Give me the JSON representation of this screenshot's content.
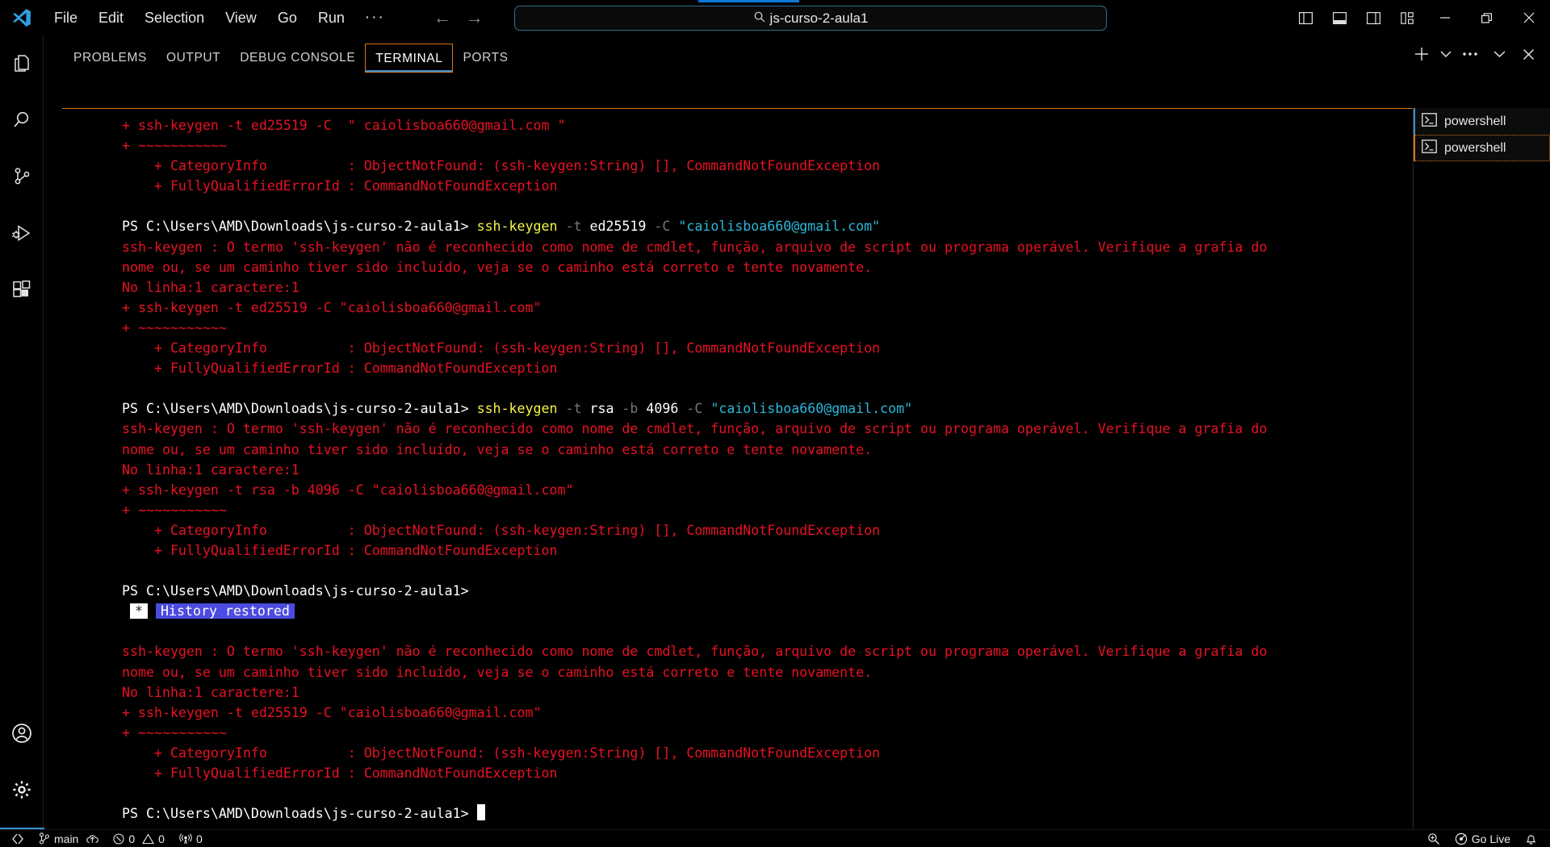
{
  "titlebar": {
    "logo_icon": "vscode-logo-icon",
    "menus": [
      "File",
      "Edit",
      "Selection",
      "View",
      "Go",
      "Run",
      "···"
    ],
    "nav": {
      "back_icon": "arrow-left-icon",
      "forward_icon": "arrow-right-icon"
    },
    "command_center": {
      "search_icon": "search-icon",
      "text": "js-curso-2-aula1",
      "progress_color": "#0a78d4"
    },
    "layout_buttons": [
      "toggle-primary-sidebar-icon",
      "toggle-panel-icon",
      "toggle-secondary-sidebar-icon",
      "customize-layout-icon"
    ],
    "window_buttons": [
      "minimize-icon",
      "restore-icon",
      "close-icon"
    ]
  },
  "activitybar": {
    "items": [
      {
        "name": "explorer",
        "icon": "files-icon"
      },
      {
        "name": "search",
        "icon": "search-icon"
      },
      {
        "name": "source-control",
        "icon": "source-control-icon"
      },
      {
        "name": "run-and-debug",
        "icon": "debug-alt-icon"
      },
      {
        "name": "extensions",
        "icon": "extensions-icon"
      }
    ],
    "bottom_items": [
      {
        "name": "accounts",
        "icon": "account-icon"
      },
      {
        "name": "manage",
        "icon": "gear-icon"
      }
    ]
  },
  "panel": {
    "tabs": [
      {
        "label": "PROBLEMS",
        "active": false
      },
      {
        "label": "OUTPUT",
        "active": false
      },
      {
        "label": "DEBUG CONSOLE",
        "active": false
      },
      {
        "label": "TERMINAL",
        "active": true
      },
      {
        "label": "PORTS",
        "active": false
      }
    ],
    "active_tab": "TERMINAL",
    "actions": [
      {
        "name": "new-terminal",
        "icon": "plus-icon"
      },
      {
        "name": "new-terminal-dropdown",
        "icon": "chevron-down-icon"
      },
      {
        "name": "panel-more-actions",
        "icon": "ellipsis-icon"
      },
      {
        "name": "hide-panel",
        "icon": "chevron-down-icon"
      },
      {
        "name": "close-panel",
        "icon": "close-icon"
      }
    ],
    "accent_border_color": "#d4761a",
    "active_tab_underline_color": "#3794d2"
  },
  "terminal_list": {
    "items": [
      {
        "label": "powershell",
        "icon": "terminal-powershell-icon",
        "selected": true,
        "focused": false
      },
      {
        "label": "powershell",
        "icon": "terminal-powershell-icon",
        "selected": true,
        "focused": true
      }
    ]
  },
  "terminal": {
    "prompt_path": "PS C:\\Users\\AMD\\Downloads\\js-curso-2-aula1>",
    "colors": {
      "error": "#e81123",
      "command": "#f5f543",
      "flag": "#767676",
      "string": "#29b8db",
      "text": "#ffffff",
      "history_highlight_bg": "#4b4bdf"
    },
    "lines": [
      {
        "type": "error",
        "text": "+ ssh-keygen -t ed25519 -C  \" caiolisboa660@gmail.com \""
      },
      {
        "type": "error",
        "text": "+ ~~~~~~~~~~~"
      },
      {
        "type": "error",
        "text": "    + CategoryInfo          : ObjectNotFound: (ssh-keygen:String) [], CommandNotFoundException"
      },
      {
        "type": "error",
        "text": "    + FullyQualifiedErrorId : CommandNotFoundException"
      },
      {
        "type": "blank",
        "text": ""
      },
      {
        "type": "prompt",
        "prompt": "PS C:\\Users\\AMD\\Downloads\\js-curso-2-aula1>",
        "cmd": "ssh-keygen",
        "args": [
          {
            "text": "-t",
            "color": "flag"
          },
          {
            "text": "ed25519",
            "color": "text"
          },
          {
            "text": "-C",
            "color": "flag"
          },
          {
            "text": "\"caiolisboa660@gmail.com\"",
            "color": "string"
          }
        ]
      },
      {
        "type": "error",
        "text": "ssh-keygen : O termo 'ssh-keygen' não é reconhecido como nome de cmdlet, função, arquivo de script ou programa operável. Verifique a grafia do"
      },
      {
        "type": "error",
        "text": "nome ou, se um caminho tiver sido incluído, veja se o caminho está correto e tente novamente."
      },
      {
        "type": "error",
        "text": "No linha:1 caractere:1"
      },
      {
        "type": "error",
        "text": "+ ssh-keygen -t ed25519 -C \"caiolisboa660@gmail.com\""
      },
      {
        "type": "error",
        "text": "+ ~~~~~~~~~~~"
      },
      {
        "type": "error",
        "text": "    + CategoryInfo          : ObjectNotFound: (ssh-keygen:String) [], CommandNotFoundException"
      },
      {
        "type": "error",
        "text": "    + FullyQualifiedErrorId : CommandNotFoundException"
      },
      {
        "type": "blank",
        "text": ""
      },
      {
        "type": "prompt",
        "prompt": "PS C:\\Users\\AMD\\Downloads\\js-curso-2-aula1>",
        "cmd": "ssh-keygen",
        "args": [
          {
            "text": "-t",
            "color": "flag"
          },
          {
            "text": "rsa",
            "color": "text"
          },
          {
            "text": "-b",
            "color": "flag"
          },
          {
            "text": "4096",
            "color": "text"
          },
          {
            "text": "-C",
            "color": "flag"
          },
          {
            "text": "\"caiolisboa660@gmail.com\"",
            "color": "string"
          }
        ]
      },
      {
        "type": "error",
        "text": "ssh-keygen : O termo 'ssh-keygen' não é reconhecido como nome de cmdlet, função, arquivo de script ou programa operável. Verifique a grafia do"
      },
      {
        "type": "error",
        "text": "nome ou, se um caminho tiver sido incluído, veja se o caminho está correto e tente novamente."
      },
      {
        "type": "error",
        "text": "No linha:1 caractere:1"
      },
      {
        "type": "error",
        "text": "+ ssh-keygen -t rsa -b 4096 -C \"caiolisboa660@gmail.com\""
      },
      {
        "type": "error",
        "text": "+ ~~~~~~~~~~~"
      },
      {
        "type": "error",
        "text": "    + CategoryInfo          : ObjectNotFound: (ssh-keygen:String) [], CommandNotFoundException"
      },
      {
        "type": "error",
        "text": "    + FullyQualifiedErrorId : CommandNotFoundException"
      },
      {
        "type": "blank",
        "text": ""
      },
      {
        "type": "plain",
        "text": "PS C:\\Users\\AMD\\Downloads\\js-curso-2-aula1>"
      },
      {
        "type": "history",
        "star": "*",
        "message": "History restored"
      },
      {
        "type": "blank",
        "text": ""
      },
      {
        "type": "error",
        "text": "ssh-keygen : O termo 'ssh-keygen' não é reconhecido como nome de cmdlet, função, arquivo de script ou programa operável. Verifique a grafia do"
      },
      {
        "type": "error",
        "text": "nome ou, se um caminho tiver sido incluído, veja se o caminho está correto e tente novamente."
      },
      {
        "type": "error",
        "text": "No linha:1 caractere:1"
      },
      {
        "type": "error",
        "text": "+ ssh-keygen -t ed25519 -C \"caiolisboa660@gmail.com\""
      },
      {
        "type": "error",
        "text": "+ ~~~~~~~~~~~"
      },
      {
        "type": "error",
        "text": "    + CategoryInfo          : ObjectNotFound: (ssh-keygen:String) [], CommandNotFoundException"
      },
      {
        "type": "error",
        "text": "    + FullyQualifiedErrorId : CommandNotFoundException"
      },
      {
        "type": "blank",
        "text": ""
      },
      {
        "type": "cursor-prompt",
        "text": "PS C:\\Users\\AMD\\Downloads\\js-curso-2-aula1>"
      }
    ]
  },
  "statusbar": {
    "left": [
      {
        "name": "remote-window",
        "icon": "remote-icon",
        "label": ""
      },
      {
        "name": "branch",
        "icon": "source-control-icon",
        "label": "main"
      },
      {
        "name": "sync-changes",
        "icon": "cloud-upload-icon",
        "label": ""
      },
      {
        "name": "problems",
        "icon": "error-warning-icon",
        "errors": "0",
        "warnings": "0"
      },
      {
        "name": "ports-forwarded",
        "icon": "radio-tower-icon",
        "label": "0"
      }
    ],
    "right": [
      {
        "name": "screencast-zoom",
        "icon": "zoom-in-icon",
        "label": ""
      },
      {
        "name": "go-live",
        "icon": "broadcast-icon",
        "label": "Go Live"
      },
      {
        "name": "notifications",
        "icon": "bell-icon",
        "label": ""
      }
    ]
  }
}
